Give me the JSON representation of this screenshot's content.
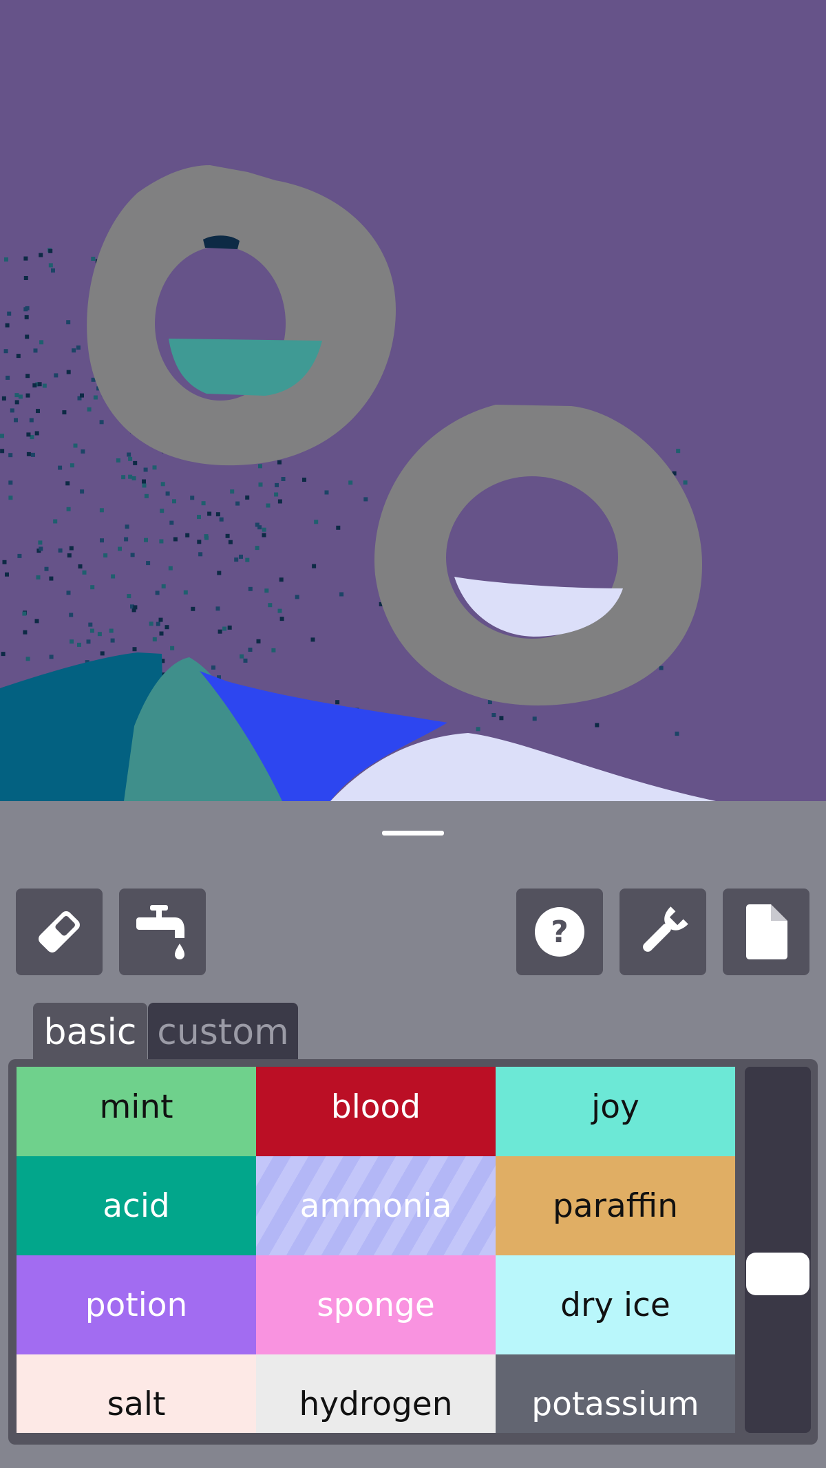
{
  "toolbar": {
    "left": [
      {
        "name": "eraser-button",
        "icon": "eraser-icon"
      },
      {
        "name": "tap-button",
        "icon": "faucet-icon"
      }
    ],
    "right": [
      {
        "name": "help-button",
        "icon": "question-icon"
      },
      {
        "name": "settings-button",
        "icon": "wrench-icon"
      },
      {
        "name": "file-button",
        "icon": "file-icon"
      }
    ]
  },
  "tabs": {
    "basic": "basic",
    "custom": "custom"
  },
  "elements": [
    {
      "label": "mint",
      "bg": "#6fd18c",
      "fg": "#111111"
    },
    {
      "label": "blood",
      "bg": "#bb0f25",
      "fg": "#ffffff"
    },
    {
      "label": "joy",
      "bg": "#6ce8d6",
      "fg": "#111111"
    },
    {
      "label": "acid",
      "bg": "#02a68b",
      "fg": "#ffffff"
    },
    {
      "label": "ammonia",
      "bg": "#c3c6f9",
      "fg": "#ffffff",
      "striped": true
    },
    {
      "label": "paraffin",
      "bg": "#e0ae64",
      "fg": "#111111"
    },
    {
      "label": "potion",
      "bg": "#a26cf1",
      "fg": "#ffffff"
    },
    {
      "label": "sponge",
      "bg": "#f993e0",
      "fg": "#ffffff"
    },
    {
      "label": "dry ice",
      "bg": "#b9f7fb",
      "fg": "#111111"
    },
    {
      "label": "salt",
      "bg": "#fde9e6",
      "fg": "#111111"
    },
    {
      "label": "hydrogen",
      "bg": "#ebebeb",
      "fg": "#111111"
    },
    {
      "label": "potassium",
      "bg": "#626571",
      "fg": "#ffffff"
    }
  ],
  "colors": {
    "sky": "#665389",
    "glass": "#808081",
    "water": "#3f9a94",
    "snow": "#dcdff9",
    "blue": "#2d46f0",
    "teal": "#036181"
  }
}
